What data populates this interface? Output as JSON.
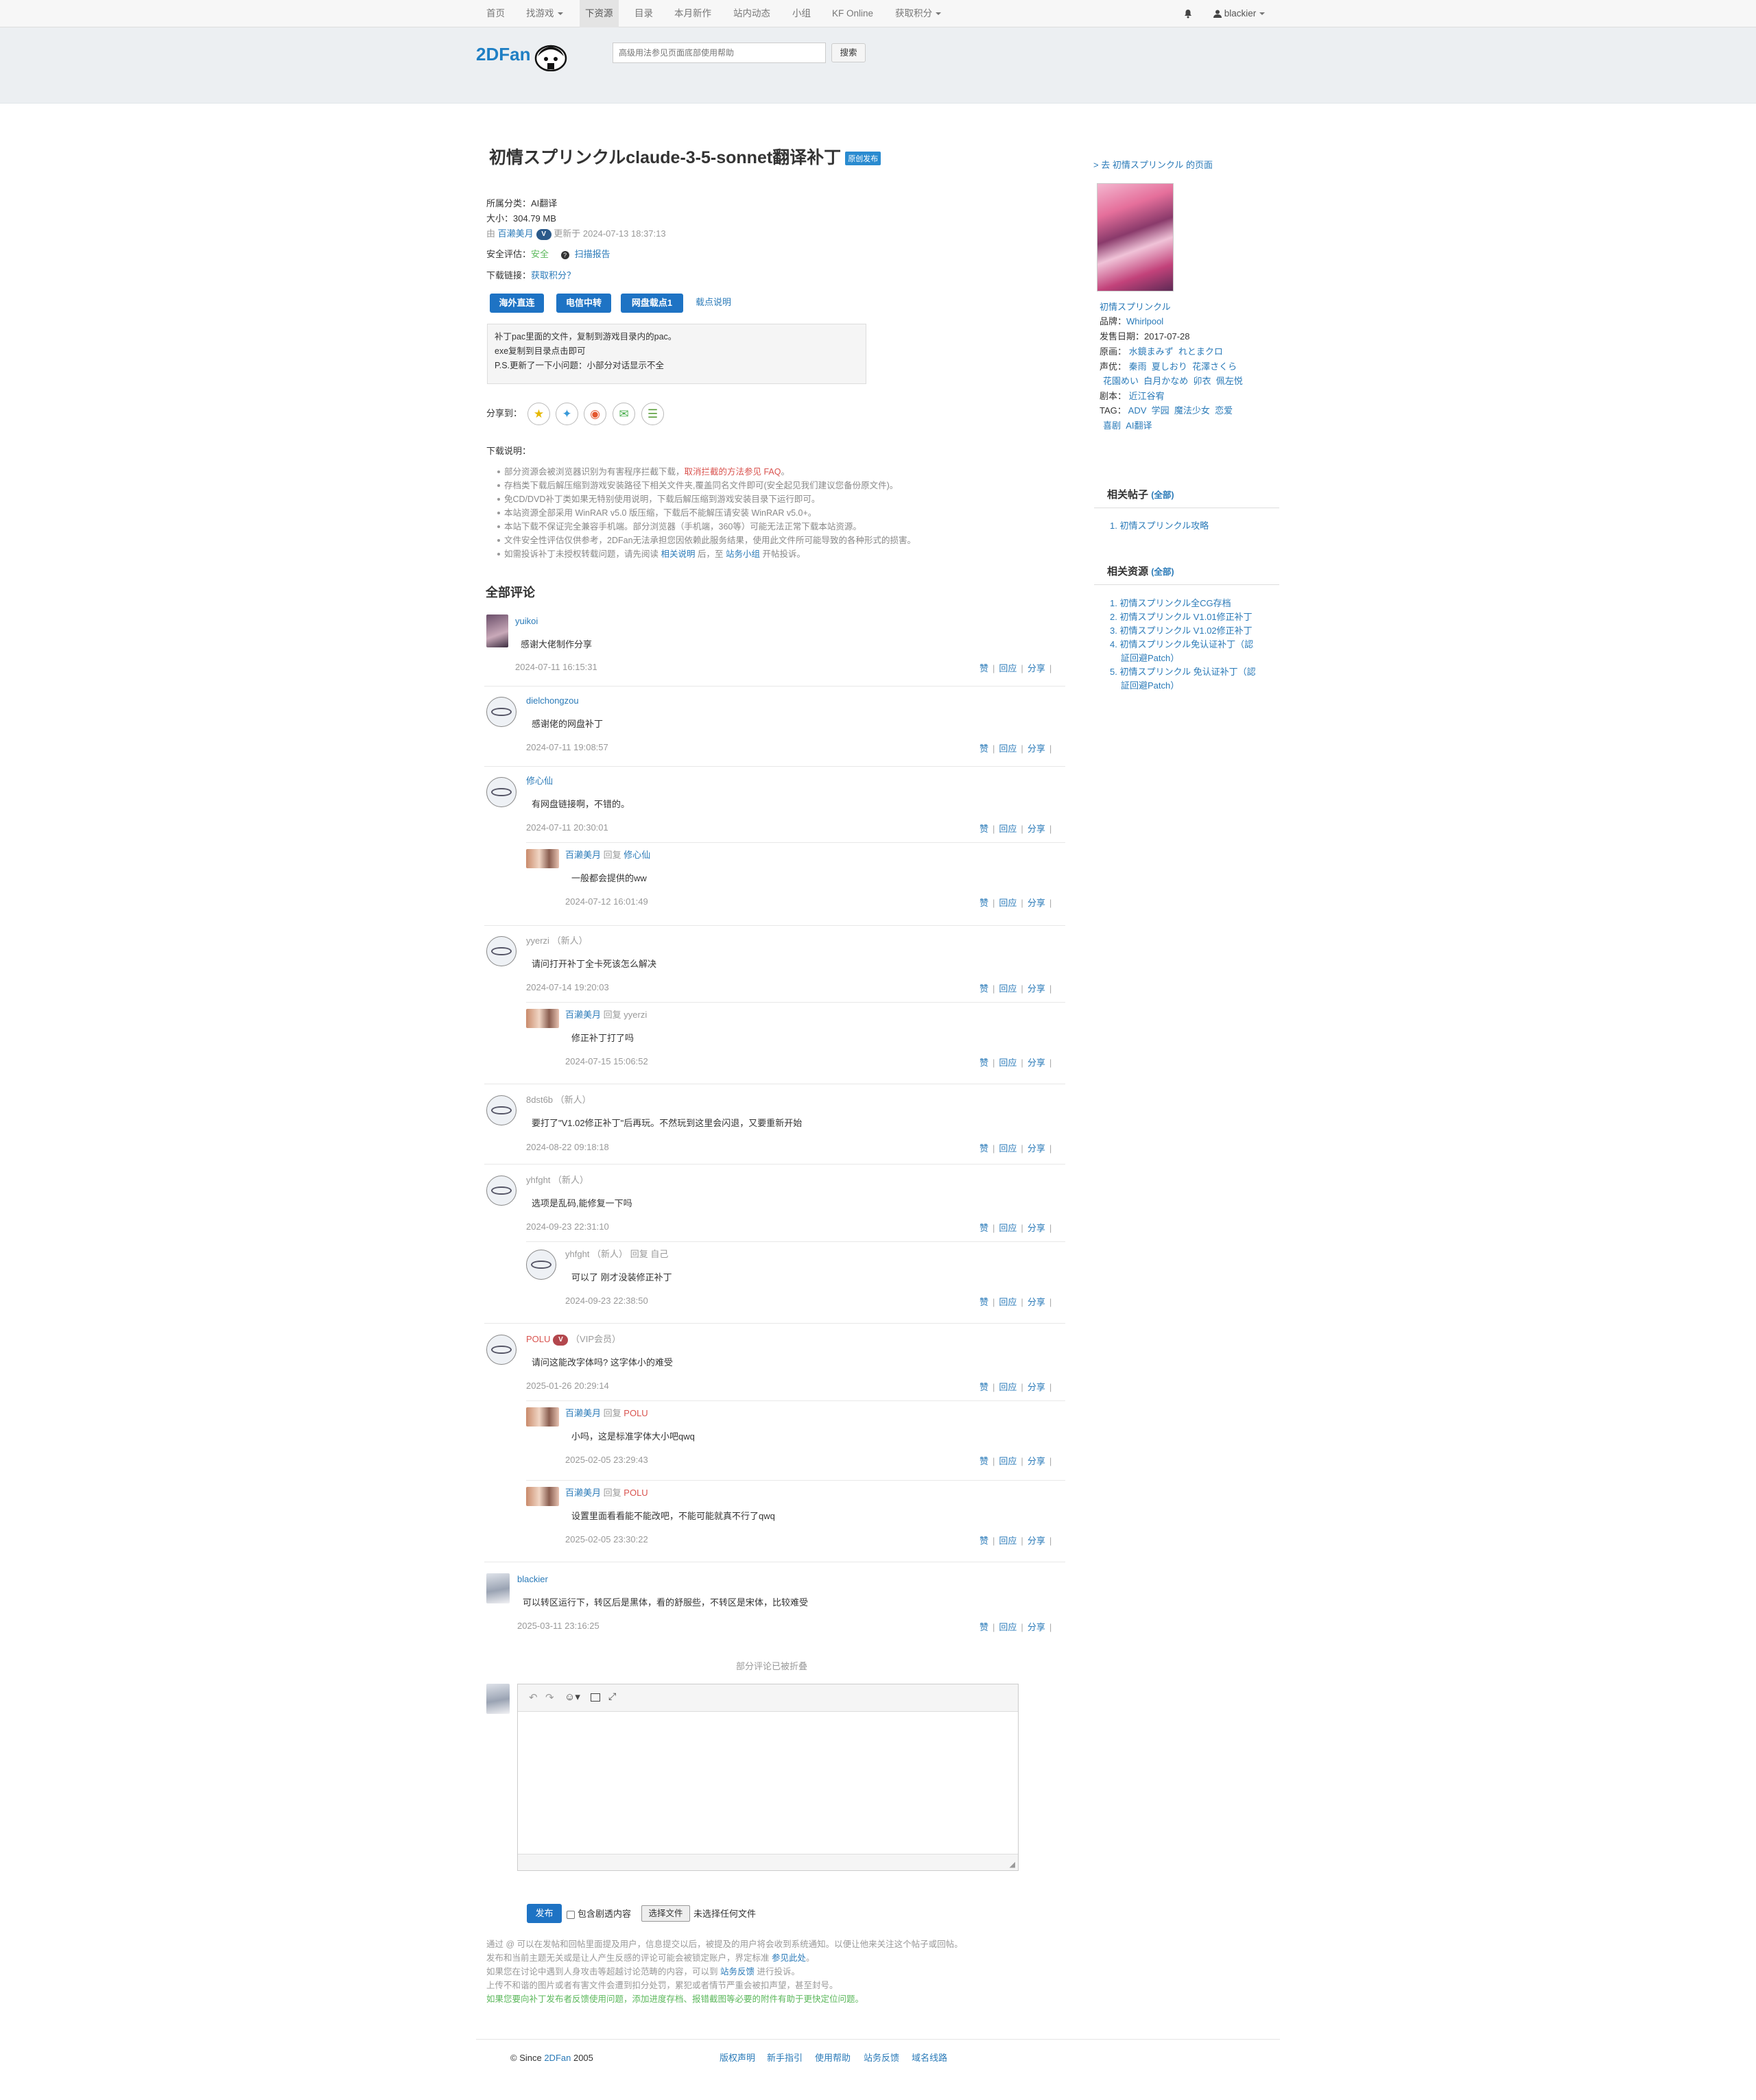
{
  "nav": {
    "items": [
      "首页",
      "找游戏",
      "下资源",
      "目录",
      "本月新作",
      "站内动态",
      "小组",
      "KF Online",
      "获取积分"
    ],
    "user": "blackier"
  },
  "header": {
    "logo": "2DFan",
    "search_placeholder": "高级用法参见页面底部使用帮助",
    "search_button": "搜索"
  },
  "resource": {
    "title": "初情スプリンクルclaude-3-5-sonnet翻译补丁",
    "badge": "原创发布",
    "category_label": "所属分类：",
    "category": "AI翻译",
    "size_label": "大小：",
    "size": "304.79 MB",
    "by_label": "由",
    "uploader": "百濑美月",
    "uploader_badge": "V",
    "updated": "更新于 2024-07-13 18:37:13",
    "safety_label": "安全评估：",
    "safety": "安全",
    "scan_report": "扫描报告",
    "download_label": "下载链接：",
    "get_points": "获取积分？",
    "buttons": [
      "海外直连",
      "电信中转",
      "网盘载点1"
    ],
    "points_help": "载点说明",
    "notes": [
      "补丁pac里面的文件，复制到游戏目录内的pac。",
      "exe复制到目录点击即可",
      "P.S.更新了一下小问题：小部分对话显示不全"
    ],
    "share_label": "分享到："
  },
  "download_notes": {
    "title": "下载说明：",
    "items": [
      {
        "text": "部分资源会被浏览器识别为有害程序拦截下载，",
        "link": "取消拦截的方法参见 FAQ",
        "after": "。"
      },
      {
        "text": "存档类下载后解压缩到游戏安装路径下相关文件夹,覆盖同名文件即可(安全起见我们建议您备份原文件)。"
      },
      {
        "text": "免CD/DVD补丁类如果无特别使用说明，下载后解压缩到游戏安装目录下运行即可。"
      },
      {
        "text": "本站资源全部采用 WinRAR v5.0 版压缩，下载后不能解压请安装 WinRAR v5.0+。"
      },
      {
        "text": "本站下载不保证完全兼容手机端。部分浏览器（手机端，360等）可能无法正常下载本站资源。"
      },
      {
        "text": "文件安全性评估仅供参考，2DFan无法承担您因依赖此服务结果，使用此文件所可能导致的各种形式的损害。"
      },
      {
        "text": "如需投诉补丁未授权转载问题，请先阅读 ",
        "link": "相关说明",
        "after": " 后，至 ",
        "link2": "站务小组",
        "after2": " 开帖投诉。"
      }
    ]
  },
  "comments_title": "全部评论",
  "actions": {
    "like": "赞",
    "reply": "回应",
    "share": "分享"
  },
  "reply_word": "回复",
  "comments": [
    {
      "user": "yuikoi",
      "text": "感谢大佬制作分享",
      "time": "2024-07-11 16:15:31"
    },
    {
      "user": "dielchongzou",
      "text": "感谢佬的网盘补丁",
      "time": "2024-07-11 19:08:57"
    },
    {
      "user": "修心仙",
      "text": "有网盘链接啊，不错的。",
      "time": "2024-07-11 20:30:01",
      "replies": [
        {
          "user": "百濑美月",
          "to": "修心仙",
          "text": "一般都会提供的ww",
          "time": "2024-07-12 16:01:49"
        }
      ]
    },
    {
      "user": "yyerzi",
      "tag": "（新人）",
      "text": "请问打开补丁全卡死该怎么解决",
      "time": "2024-07-14 19:20:03",
      "replies": [
        {
          "user": "百濑美月",
          "to": "yyerzi",
          "text": "修正补丁打了吗",
          "time": "2024-07-15 15:06:52"
        }
      ]
    },
    {
      "user": "8dst6b",
      "tag": "（新人）",
      "text": "要打了\"V1.02修正补丁\"后再玩。不然玩到这里会闪退，又要重新开始",
      "time": "2024-08-22 09:18:18"
    },
    {
      "user": "yhfght",
      "tag": "（新人）",
      "text": "选项是乱码,能修复一下吗",
      "time": "2024-09-23 22:31:10",
      "replies": [
        {
          "user": "yhfght",
          "tag": "（新人）",
          "to": "自己",
          "text": "可以了 刚才没装修正补丁",
          "time": "2024-09-23 22:38:50"
        }
      ]
    },
    {
      "user": "POLU",
      "badge": "V",
      "tag": "（VIP会员）",
      "text": "请问这能改字体吗? 这字体小的难受",
      "time": "2025-01-26 20:29:14",
      "replies": [
        {
          "user": "百濑美月",
          "to": "POLU",
          "text": "小吗，这是标准字体大小吧qwq",
          "time": "2025-02-05 23:29:43"
        },
        {
          "user": "百濑美月",
          "to": "POLU",
          "text": "设置里面看看能不能改吧，不能可能就真不行了qwq",
          "time": "2025-02-05 23:30:22"
        }
      ]
    },
    {
      "user": "blackier",
      "text": "可以转区运行下，转区后是黑体，看的舒服些，不转区是宋体，比较难受",
      "time": "2025-03-11 23:16:25"
    }
  ],
  "folded": "部分评论已被折叠",
  "post": {
    "submit": "发布",
    "spoiler": "包含剧透内容",
    "choose_file": "选择文件",
    "no_file": "未选择任何文件"
  },
  "tips": [
    {
      "text": "通过 @ 可以在发帖和回帖里面提及用户，信息提交以后，被提及的用户将会收到系统通知。以便让他来关注这个帖子或回帖。"
    },
    {
      "text": "发布和当前主题无关或是让人产生反感的评论可能会被锁定账户，界定标准 ",
      "link": "参见此处",
      "after": "。"
    },
    {
      "text": "如果您在讨论中遇到人身攻击等超越讨论范畴的内容，可以到 ",
      "link": "站务反馈",
      "after": " 进行投诉。"
    },
    {
      "text": "上传不和谐的图片或者有害文件会遭到扣分处罚，累犯或者情节严重会被扣声望，甚至封号。"
    },
    {
      "text": "如果您要向补丁发布者反馈使用问题，添加进度存档、报错截图等必要的附件有助于更快定位问题。",
      "green": true
    }
  ],
  "sidebar": {
    "goto": "> 去 初情スプリンクル 的页面",
    "game_name": "初情スプリンクル",
    "brand_label": "品牌：",
    "brand": "Whirlpool",
    "release_label": "发售日期：",
    "release": "2017-07-28",
    "art_label": "原画：",
    "art": [
      "水鏡まみず",
      "れとまクロ"
    ],
    "cv_label": "声优：",
    "cv": [
      "秦雨",
      "夏しおり",
      "花澤さくら",
      "花園めい",
      "白月かなめ",
      "卯衣",
      "佩左悦"
    ],
    "writer_label": "剧本：",
    "writer": "近江谷宥",
    "tag_label": "TAG：",
    "tags": [
      "ADV",
      "学园",
      "魔法少女",
      "恋爱",
      "喜剧",
      "AI翻译"
    ],
    "related_posts_title": "相关帖子",
    "all": "(全部)",
    "related_posts": [
      "1. 初情スプリンクル攻略"
    ],
    "related_res_title": "相关资源",
    "related_res": [
      "1. 初情スプリンクル全CG存档",
      "2. 初情スプリンクル V1.01修正补丁",
      "3. 初情スプリンクル V1.02修正补丁",
      "4. 初情スプリンクル免认证补丁（認",
      "証回避Patch）",
      "5. 初情スプリンクル 免认证补丁（認",
      "証回避Patch）"
    ]
  },
  "footer": {
    "copy_prefix": "© Since ",
    "copy_brand": "2DFan",
    "copy_year": " 2005",
    "links": [
      "版权声明",
      "新手指引",
      "使用帮助",
      "站务反馈",
      "域名线路"
    ]
  }
}
